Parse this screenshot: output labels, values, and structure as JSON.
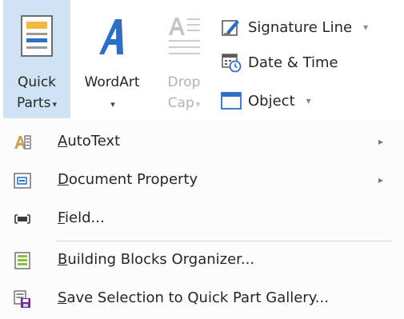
{
  "ribbon": {
    "quick_parts": {
      "line1": "Quick",
      "line2": "Parts",
      "caret": "▾"
    },
    "wordart": {
      "line1": "WordArt",
      "caret": "▾"
    },
    "drop_cap": {
      "line1": "Drop",
      "line2": "Cap",
      "caret": "▾"
    },
    "signature_line": {
      "label": "Signature Line",
      "caret": "▾"
    },
    "date_time": {
      "label": "Date & Time"
    },
    "object": {
      "label": "Object",
      "caret": "▾"
    }
  },
  "menu": {
    "items": [
      {
        "mnemonic": "A",
        "rest": "utoText",
        "has_submenu": true,
        "icon": "autotext-icon"
      },
      {
        "mnemonic": "D",
        "rest": "ocument Property",
        "has_submenu": true,
        "icon": "document-property-icon"
      },
      {
        "mnemonic": "F",
        "rest": "ield...",
        "has_submenu": false,
        "icon": "field-icon"
      },
      {
        "mnemonic": "B",
        "rest": "uilding Blocks Organizer...",
        "has_submenu": false,
        "icon": "building-blocks-icon"
      },
      {
        "mnemonic": "S",
        "rest": "ave Selection to Quick Part Gallery...",
        "has_submenu": false,
        "icon": "save-selection-icon"
      }
    ],
    "submenu_arrow": "▸"
  },
  "colors": {
    "selected_button_bg": "#cfe3f4",
    "accent_blue": "#2e6fc4",
    "purple": "#6b2d8a",
    "menu_bg": "#fcfcfc"
  }
}
